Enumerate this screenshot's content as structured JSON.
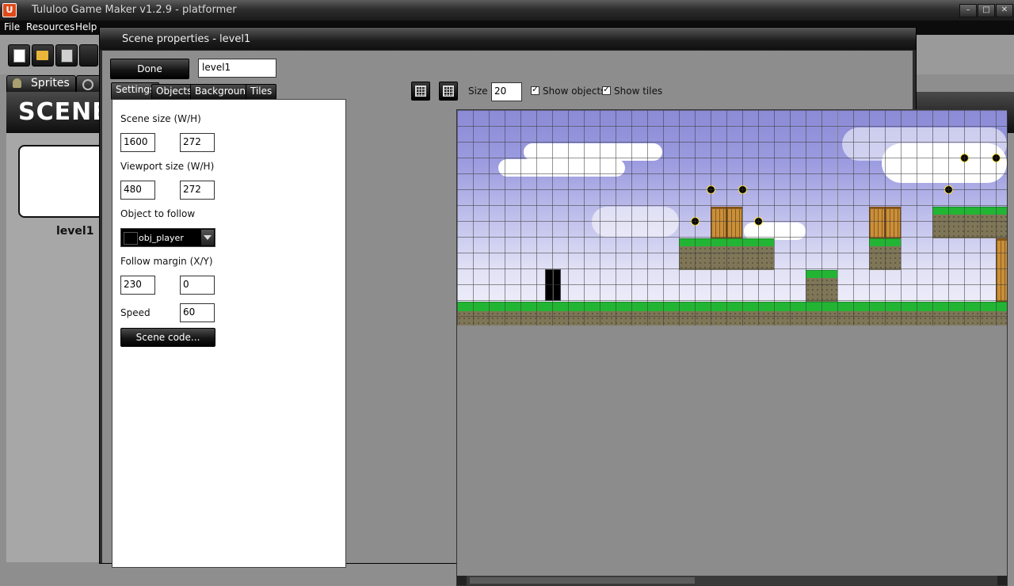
{
  "window": {
    "title": "Tululoo Game Maker v1.2.9 - platformer",
    "icon_letter": "U",
    "controls": {
      "minimize": "–",
      "maximize": "□",
      "close": "✕"
    }
  },
  "menu": {
    "file": "File",
    "resources": "Resources",
    "help": "Help"
  },
  "toolbar": {
    "icons": [
      "new-file-icon",
      "open-folder-icon",
      "save-icon"
    ]
  },
  "resource_tabs": {
    "sprites": "Sprites"
  },
  "scene_section": {
    "header": "SCENE",
    "thumbnail_label": "level1"
  },
  "dialog": {
    "title": "Scene properties - level1",
    "done_label": "Done",
    "scene_name": "level1",
    "tabs": [
      "Settings",
      "Objects",
      "Background",
      "Tiles"
    ],
    "grid": {
      "size_label": "Size",
      "size_value": "20",
      "show_objects": "Show objects",
      "show_tiles": "Show tiles"
    },
    "settings": {
      "scene_size_label": "Scene size (W/H)",
      "scene_width": "1600",
      "scene_height": "272",
      "viewport_label": "Viewport size (W/H)",
      "viewport_width": "480",
      "viewport_height": "272",
      "follow_label": "Object to follow",
      "follow_object": "obj_player",
      "margin_label": "Follow margin (X/Y)",
      "margin_x": "230",
      "margin_y": "0",
      "speed_label": "Speed",
      "speed_value": "60",
      "scene_code_label": "Scene code..."
    }
  },
  "colors": {
    "grass": "#22b534",
    "dirt": "#7f7658",
    "sky_top": "#8a8ad6",
    "crate": "#c98f3a"
  }
}
